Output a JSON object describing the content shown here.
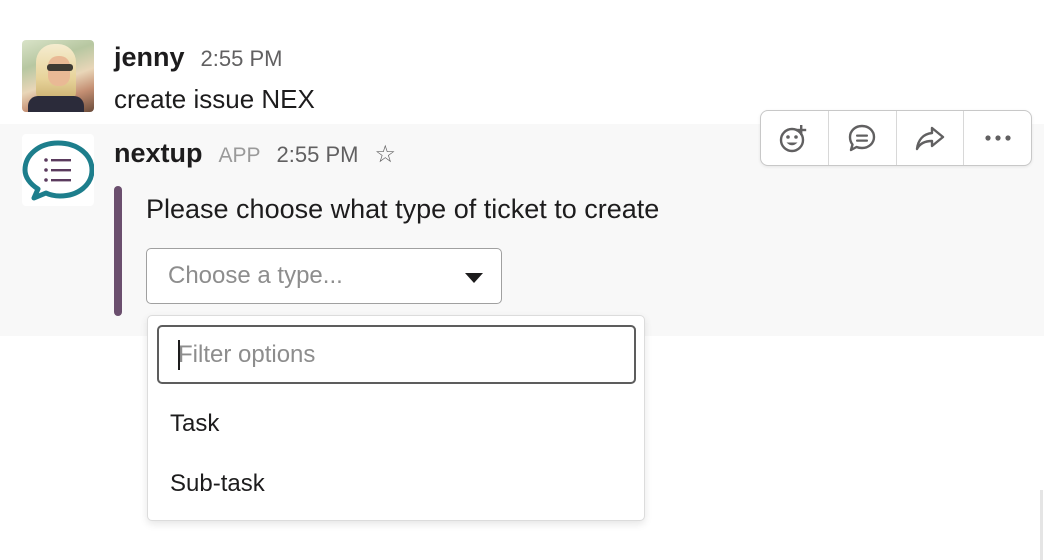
{
  "messages": [
    {
      "author": "jenny",
      "time": "2:55 PM",
      "text": "create issue NEX"
    },
    {
      "author": "nextup",
      "badge": "APP",
      "time": "2:55 PM",
      "attachment": {
        "text": "Please choose what type of ticket to create",
        "bar_color": "#6b4f6e",
        "select": {
          "placeholder": "Choose a type..."
        }
      }
    }
  ],
  "dropdown": {
    "filter_placeholder": "Filter options",
    "options": [
      "Task",
      "Sub-task"
    ]
  },
  "toolbar": {
    "buttons": [
      "add-reaction-icon",
      "start-thread-icon",
      "share-message-icon",
      "more-actions-icon"
    ]
  },
  "colors": {
    "app_logo_ring": "#1d7e8c",
    "app_logo_lines": "#5b3b5e",
    "hover_row_background": "#f8f8f8"
  }
}
